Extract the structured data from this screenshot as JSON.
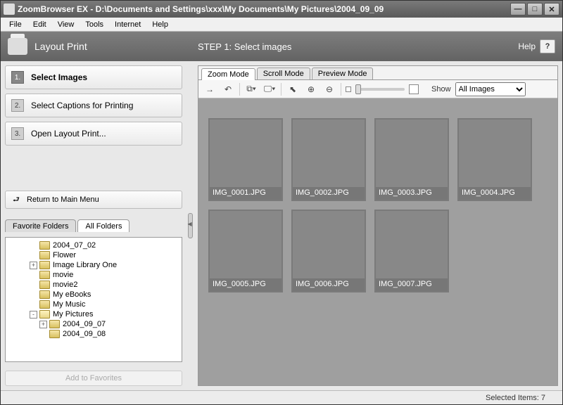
{
  "window": {
    "title": "ZoomBrowser EX  -  D:\\Documents and Settings\\xxx\\My Documents\\My Pictures\\2004_09_09"
  },
  "menu": [
    "File",
    "Edit",
    "View",
    "Tools",
    "Internet",
    "Help"
  ],
  "header": {
    "section": "Layout Print",
    "step": "STEP 1: Select images",
    "help": "Help",
    "helpbtn": "?"
  },
  "steps": [
    {
      "num": "1.",
      "label": "Select Images",
      "active": true
    },
    {
      "num": "2.",
      "label": "Select Captions for Printing",
      "active": false
    },
    {
      "num": "3.",
      "label": "Open Layout Print...",
      "active": false
    }
  ],
  "returnbtn": {
    "icon": "⮐",
    "label": "Return to Main Menu"
  },
  "foldertabs": [
    {
      "label": "Favorite Folders",
      "active": false
    },
    {
      "label": "All Folders",
      "active": true
    }
  ],
  "tree": [
    {
      "indent": 2,
      "exp": "",
      "label": "2004_07_02"
    },
    {
      "indent": 2,
      "exp": "",
      "label": "Flower"
    },
    {
      "indent": 2,
      "exp": "+",
      "label": "Image Library One"
    },
    {
      "indent": 2,
      "exp": "",
      "label": "movie"
    },
    {
      "indent": 2,
      "exp": "",
      "label": "movie2"
    },
    {
      "indent": 2,
      "exp": "",
      "label": "My eBooks"
    },
    {
      "indent": 2,
      "exp": "",
      "label": "My Music"
    },
    {
      "indent": 2,
      "exp": "-",
      "label": "My Pictures",
      "open": true
    },
    {
      "indent": 3,
      "exp": "+",
      "label": "2004_09_07"
    },
    {
      "indent": 3,
      "exp": "",
      "label": "2004_09_08"
    }
  ],
  "addfav": "Add to Favorites",
  "viewtabs": [
    {
      "label": "Zoom Mode",
      "active": true
    },
    {
      "label": "Scroll Mode",
      "active": false
    },
    {
      "label": "Preview Mode",
      "active": false
    }
  ],
  "toolbar": {
    "show_label": "Show",
    "filter_options": [
      "All Images"
    ],
    "filter_selected": "All Images"
  },
  "thumbs": [
    {
      "label": "IMG_0001.JPG",
      "cls": "p1"
    },
    {
      "label": "IMG_0002.JPG",
      "cls": "p2"
    },
    {
      "label": "IMG_0003.JPG",
      "cls": "p3"
    },
    {
      "label": "IMG_0004.JPG",
      "cls": "p4"
    },
    {
      "label": "IMG_0005.JPG",
      "cls": "p5"
    },
    {
      "label": "IMG_0006.JPG",
      "cls": "p6"
    },
    {
      "label": "IMG_0007.JPG",
      "cls": "p7"
    }
  ],
  "status": {
    "selected": "Selected Items: 7"
  }
}
